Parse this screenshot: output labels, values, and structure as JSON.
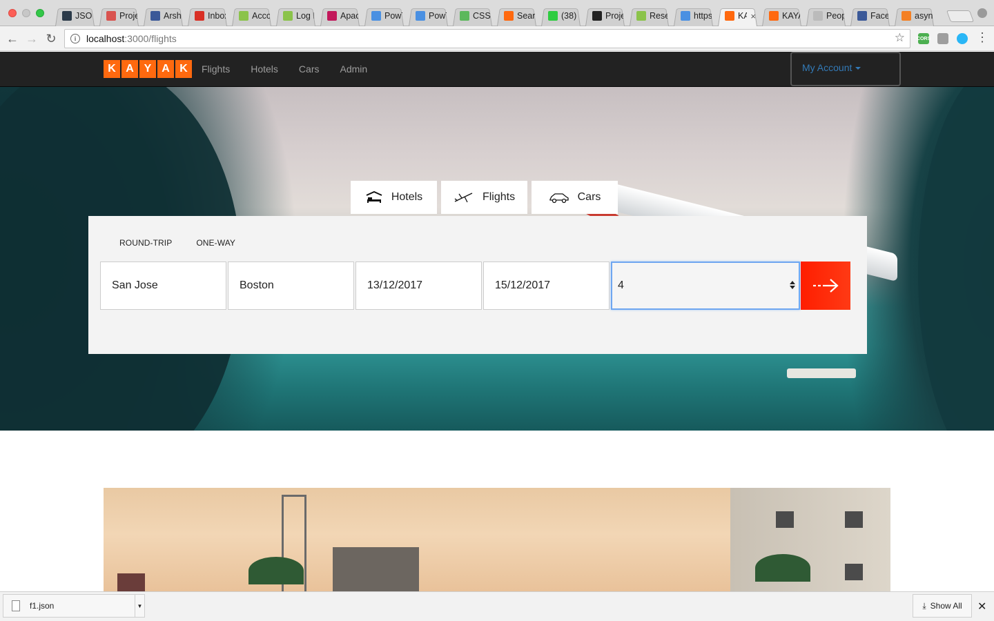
{
  "browser": {
    "tabs": [
      {
        "label": "JSO",
        "favicon_color": "#2b3a49"
      },
      {
        "label": "Proje",
        "favicon_color": "#d9534f"
      },
      {
        "label": "Arsh",
        "favicon_color": "#3b5998"
      },
      {
        "label": "Inbox",
        "favicon_color": "#d93025"
      },
      {
        "label": "Acco",
        "favicon_color": "#8bc34a"
      },
      {
        "label": "Log I",
        "favicon_color": "#8bc34a"
      },
      {
        "label": "Apac",
        "favicon_color": "#c2185b"
      },
      {
        "label": "PowT",
        "favicon_color": "#4a90e2"
      },
      {
        "label": "PowT",
        "favicon_color": "#4a90e2"
      },
      {
        "label": "CSS",
        "favicon_color": "#5cb85c"
      },
      {
        "label": "Sear",
        "favicon_color": "#ff690f"
      },
      {
        "label": "(38)",
        "favicon_color": "#2ecc40"
      },
      {
        "label": "Proje",
        "favicon_color": "#222222"
      },
      {
        "label": "Rese",
        "favicon_color": "#8bc34a"
      },
      {
        "label": "https",
        "favicon_color": "#4a90e2"
      },
      {
        "label": "KA",
        "favicon_color": "#ff690f",
        "active": true
      },
      {
        "label": "KAYA",
        "favicon_color": "#ff690f"
      },
      {
        "label": "Peop",
        "favicon_color": "#bbbbbb"
      },
      {
        "label": "Face",
        "favicon_color": "#3b5998"
      },
      {
        "label": "asyn",
        "favicon_color": "#f48024"
      }
    ],
    "url_host": "localhost",
    "url_path": ":3000/flights",
    "extensions": [
      {
        "label": "CORS",
        "color": "#4caf50"
      },
      {
        "label": "",
        "color": "#9e9e9e"
      },
      {
        "label": "",
        "color": "#29b6f6"
      }
    ]
  },
  "nav": {
    "logo_letters": [
      "K",
      "A",
      "Y",
      "A",
      "K"
    ],
    "links": [
      "Flights",
      "Hotels",
      "Cars",
      "Admin"
    ],
    "account_label": "My Account"
  },
  "search": {
    "tabs": [
      {
        "label": "Hotels",
        "icon": "hotel-bed-icon"
      },
      {
        "label": "Flights",
        "icon": "airplane-icon"
      },
      {
        "label": "Cars",
        "icon": "car-icon"
      }
    ],
    "trip_types": [
      "ROUND-TRIP",
      "ONE-WAY"
    ],
    "from": "San Jose",
    "to": "Boston",
    "depart_date": "13/12/2017",
    "return_date": "15/12/2017",
    "travelers": "4",
    "go_icon": "dashed-arrow-right-icon"
  },
  "download": {
    "filename": "f1.json",
    "show_all_label": "Show All"
  },
  "colors": {
    "kayak_orange": "#ff690f",
    "search_red": "#ff2000",
    "account_link": "#337ab7",
    "navbar_bg": "#222222"
  }
}
